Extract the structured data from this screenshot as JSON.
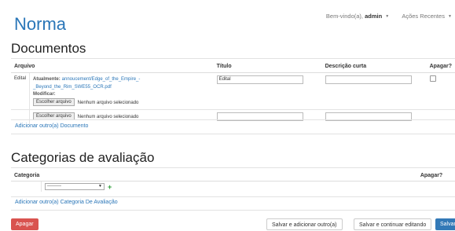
{
  "brand": "Norma",
  "nav": {
    "welcome_prefix": "Bem-vindo(a),",
    "username": "admin",
    "recent_actions": "Ações Recentes"
  },
  "documents": {
    "title": "Documentos",
    "headers": [
      "Arquivo",
      "Título",
      "Descrição curta",
      "Apagar?"
    ],
    "rows": [
      {
        "label": "Edital",
        "current_label": "Atualmente:",
        "current_file": "annoucement/Edge_of_the_Empire_-_Beyond_the_Rim_SWE55_OCR.pdf",
        "modify_label": "Modificar:",
        "choose_button": "Escolher arquivo",
        "no_file": "Nenhum arquivo selecionado",
        "title_value": "Edital",
        "description_value": ""
      },
      {
        "choose_button": "Escolher arquivo",
        "no_file": "Nenhum arquivo selecionado",
        "title_value": "",
        "description_value": ""
      }
    ],
    "add_link": "Adicionar outro(a) Documento"
  },
  "categories": {
    "title": "Categorias de avaliação",
    "headers": [
      "Categoria",
      "Apagar?"
    ],
    "select_value": "---------",
    "add_link": "Adicionar outro(a) Categoria De Avaliação"
  },
  "actions": {
    "delete": "Apagar",
    "save_add": "Salvar e adicionar outro(a)",
    "save_continue": "Salvar e continuar editando",
    "save": "Salvar"
  }
}
